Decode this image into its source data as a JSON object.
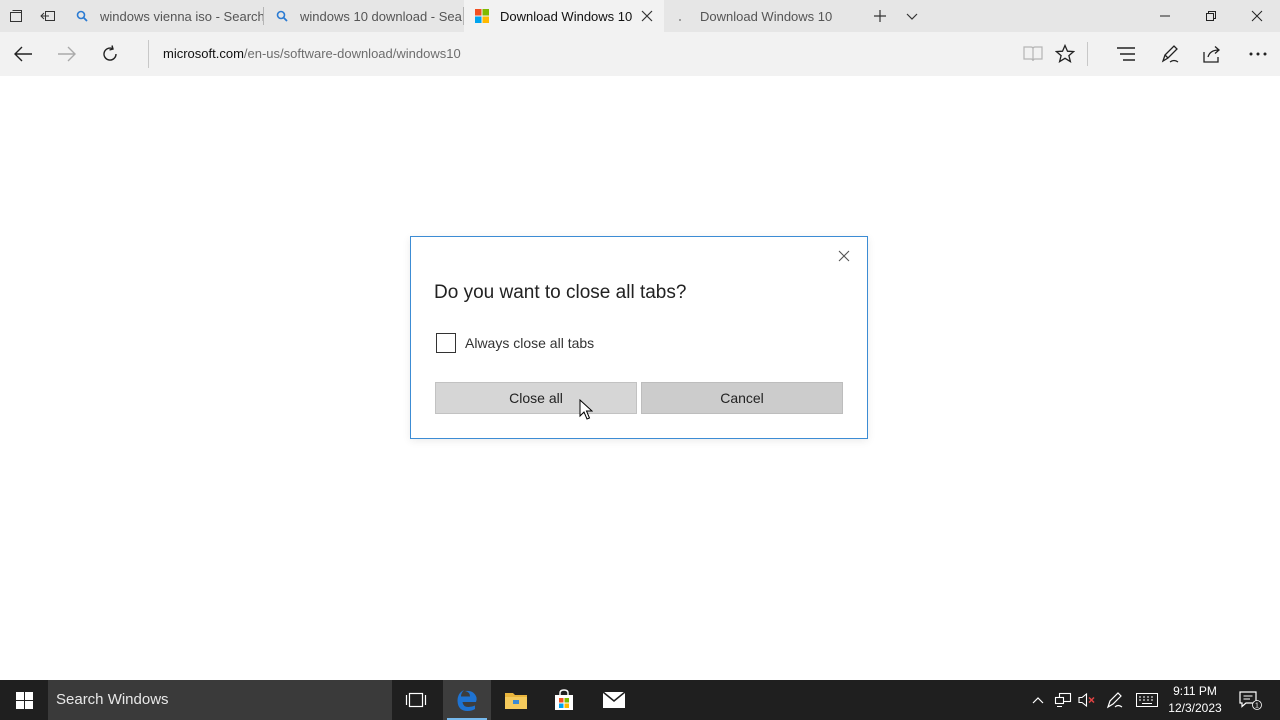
{
  "browser": {
    "tabs": [
      {
        "title": "windows vienna iso - Search",
        "favicon": "search-icon"
      },
      {
        "title": "windows 10 download - Sea",
        "favicon": "search-icon"
      },
      {
        "title": "Download Windows 10",
        "favicon": "microsoft-logo",
        "active": true
      },
      {
        "title": "Download Windows 10",
        "favicon": "loading-icon"
      }
    ],
    "address": {
      "host": "microsoft.com",
      "path": "/en-us/software-download/windows10"
    }
  },
  "dialog": {
    "title": "Do you want to close all tabs?",
    "checkbox_label": "Always close all tabs",
    "checkbox_checked": false,
    "primary_button": "Close all",
    "secondary_button": "Cancel"
  },
  "taskbar": {
    "search_placeholder": "Search Windows",
    "time": "9:11 PM",
    "date": "12/3/2023",
    "notification_count": "1"
  },
  "colors": {
    "dialog_border": "#3c8cd4",
    "taskbar_bg": "#1f1f1f",
    "edge_blue": "#1e73d2",
    "active_app_indicator": "#76b9ed"
  }
}
